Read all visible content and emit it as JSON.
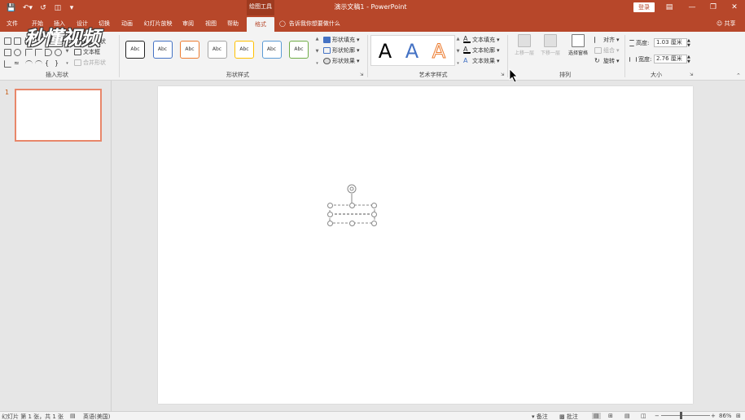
{
  "app": {
    "doc_title": "演示文稿1 - PowerPoint",
    "tool_tab_group": "绘图工具",
    "login": "登录",
    "share": "共享",
    "tell_me": "告诉我你想要做什么",
    "watermark": "秒懂视频"
  },
  "tabs": [
    {
      "label": "文件"
    },
    {
      "label": "开始"
    },
    {
      "label": "插入"
    },
    {
      "label": "设计"
    },
    {
      "label": "切换"
    },
    {
      "label": "动画"
    },
    {
      "label": "幻灯片放映"
    },
    {
      "label": "审阅"
    },
    {
      "label": "视图"
    },
    {
      "label": "帮助"
    },
    {
      "label": "格式",
      "active": true
    }
  ],
  "ribbon": {
    "insert_shapes": {
      "label": "插入形状",
      "edit_shape": "编辑形状",
      "text_box": "文本框",
      "merge_shapes": "合并形状"
    },
    "shape_styles": {
      "label": "形状样式",
      "style_samples": [
        "Abc",
        "Abc",
        "Abc",
        "Abc",
        "Abc",
        "Abc",
        "Abc"
      ],
      "style_colors": [
        "#222222",
        "#4472c4",
        "#ed7d31",
        "#a5a5a5",
        "#ffc000",
        "#5b9bd5",
        "#70ad47"
      ],
      "fill": "形状填充",
      "outline": "形状轮廓",
      "effects": "形状效果"
    },
    "wordart": {
      "label": "艺术字样式",
      "samples": [
        "A",
        "A",
        "A"
      ],
      "sample_colors": [
        "#000000",
        "#4472c4",
        "#f4b183"
      ],
      "text_fill": "文本填充",
      "text_outline": "文本轮廓",
      "text_effects": "文本效果"
    },
    "arrange": {
      "label": "排列",
      "bring_forward": "上移一层",
      "send_backward": "下移一层",
      "selection_pane": "选择窗格",
      "align": "对齐",
      "group": "组合",
      "rotate": "旋转"
    },
    "size": {
      "label": "大小",
      "height_label": "高度:",
      "height_value": "1.03 厘米",
      "width_label": "宽度:",
      "width_value": "2.76 厘米"
    }
  },
  "slides_pane": {
    "slide_number": "1"
  },
  "status": {
    "slide_info": "幻灯片 第 1 张，共 1 张",
    "language": "英语(美国)",
    "notes": "备注",
    "comments": "批注",
    "zoom": "86%"
  }
}
